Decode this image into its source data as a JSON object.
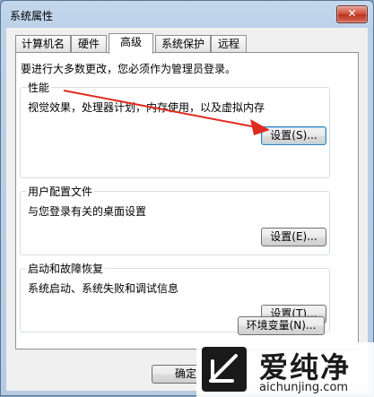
{
  "window": {
    "title": "系统属性",
    "close_label": "✕"
  },
  "tabs": [
    {
      "label": "计算机名"
    },
    {
      "label": "硬件"
    },
    {
      "label": "高级",
      "active": true
    },
    {
      "label": "系统保护"
    },
    {
      "label": "远程"
    }
  ],
  "admin_note": "要进行大多数更改，您必须作为管理员登录。",
  "groups": {
    "performance": {
      "title": "性能",
      "desc": "视觉效果，处理器计划，内存使用，以及虚拟内存",
      "button": "设置(S)..."
    },
    "profile": {
      "title": "用户配置文件",
      "desc": "与您登录有关的桌面设置",
      "button": "设置(E)..."
    },
    "startup": {
      "title": "启动和故障恢复",
      "desc": "系统启动、系统失败和调试信息",
      "button": "设置(T)..."
    }
  },
  "env_button": "环境变量(N)...",
  "ok_button": "确定",
  "annotation": {
    "color": "#e02b20"
  },
  "watermark": {
    "text": "爱纯净",
    "url": "aichunjing.com"
  }
}
